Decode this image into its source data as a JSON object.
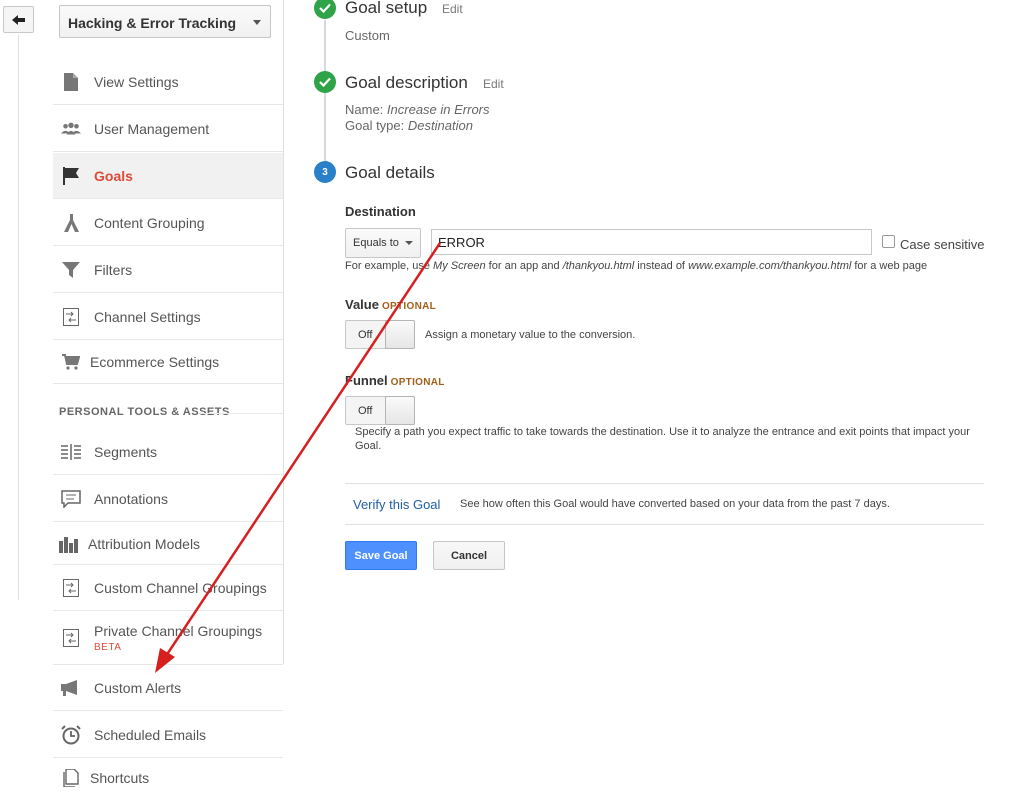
{
  "view_selector": {
    "value": "Hacking & Error Tracking"
  },
  "sidebar": {
    "items": [
      {
        "label": "View Settings",
        "icon": "page-icon"
      },
      {
        "label": "User Management",
        "icon": "users-icon"
      },
      {
        "label": "Goals",
        "icon": "flag-icon",
        "active": true
      },
      {
        "label": "Content Grouping",
        "icon": "grouping-icon"
      },
      {
        "label": "Filters",
        "icon": "filter-icon"
      },
      {
        "label": "Channel Settings",
        "icon": "channel-icon"
      },
      {
        "label": "Ecommerce Settings",
        "icon": "cart-icon"
      }
    ],
    "section_header": "PERSONAL TOOLS & ASSETS",
    "tools": [
      {
        "label": "Segments",
        "icon": "segments-icon"
      },
      {
        "label": "Annotations",
        "icon": "annotation-icon"
      },
      {
        "label": "Attribution Models",
        "icon": "bar-chart-icon"
      },
      {
        "label": "Custom Channel Groupings",
        "icon": "channel-icon"
      },
      {
        "label": "Private Channel Groupings",
        "badge": "BETA",
        "icon": "channel-icon"
      },
      {
        "label": "Custom Alerts",
        "icon": "megaphone-icon"
      },
      {
        "label": "Scheduled Emails",
        "icon": "clock-icon"
      },
      {
        "label": "Shortcuts",
        "icon": "document-icon"
      }
    ]
  },
  "goal": {
    "setup": {
      "title": "Goal setup",
      "edit": "Edit",
      "value": "Custom"
    },
    "description": {
      "title": "Goal description",
      "edit": "Edit",
      "name_label": "Name:",
      "name_value": "Increase in Errors",
      "type_label": "Goal type:",
      "type_value": "Destination"
    },
    "details": {
      "step_number": "3",
      "title": "Goal details",
      "destination_label": "Destination",
      "match_type": "Equals to",
      "destination_value": "ERROR",
      "case_sensitive_label": "Case sensitive",
      "hint": {
        "p1": "For example, use ",
        "p2": "My Screen",
        "p3": " for an app and ",
        "p4": "/thankyou.html",
        "p5": " instead of ",
        "p6": "www.example.com/thankyou.html",
        "p7": " for a web page"
      },
      "value_label": "Value",
      "value_optional": "OPTIONAL",
      "value_toggle": "Off",
      "value_hint": "Assign a monetary value to the conversion.",
      "funnel_label": "Funnel",
      "funnel_optional": "OPTIONAL",
      "funnel_toggle": "Off",
      "funnel_hint_line1": "Specify a path you expect traffic to take towards the destination. Use it to analyze the entrance and exit points that impact your",
      "funnel_hint_line2": "Goal."
    },
    "verify_link": "Verify this Goal",
    "verify_hint": "See how often this Goal would have converted based on your data from the past 7 days.",
    "save_button": "Save Goal",
    "cancel_button": "Cancel"
  },
  "colors": {
    "active_nav": "#dd4b39",
    "step_done": "#2ea347",
    "step_current": "#2a7fc9",
    "primary_button": "#4d90fe",
    "link": "#1f5fa6",
    "optional": "#a25e1a",
    "annotation_arrow": "#d61f1f"
  }
}
